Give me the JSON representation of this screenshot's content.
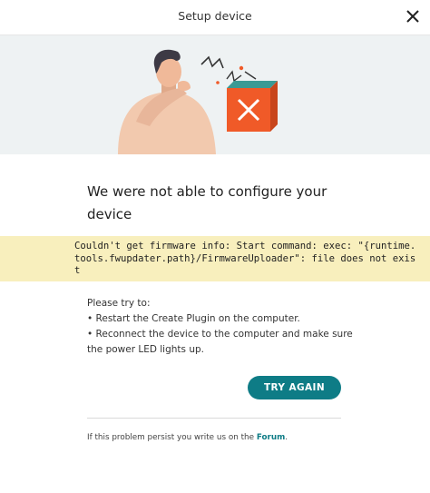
{
  "dialog": {
    "title": "Setup device",
    "close_icon": "close-icon"
  },
  "illustration": {
    "icon": "person-thinking-with-broken-box-illustration",
    "accent_color": "#f05a28",
    "teal_color": "#3a9a94"
  },
  "message": {
    "headline": "We were not able to configure your device"
  },
  "error": {
    "text": "Couldn't get firmware info: Start command: exec: \"{runtime.tools.fwupdater.path}/FirmwareUploader\": file does not exist",
    "background": "#f8efbd"
  },
  "advice": {
    "intro": "Please try to:",
    "items": [
      "• Restart the Create Plugin on the computer.",
      "• Reconnect the device to the computer and make sure the power LED lights up."
    ]
  },
  "actions": {
    "try_again_label": "TRY AGAIN",
    "button_color": "#0e7c86"
  },
  "footer": {
    "prefix": "If this problem persist you write us on the ",
    "link_label": "Forum",
    "suffix": "."
  }
}
